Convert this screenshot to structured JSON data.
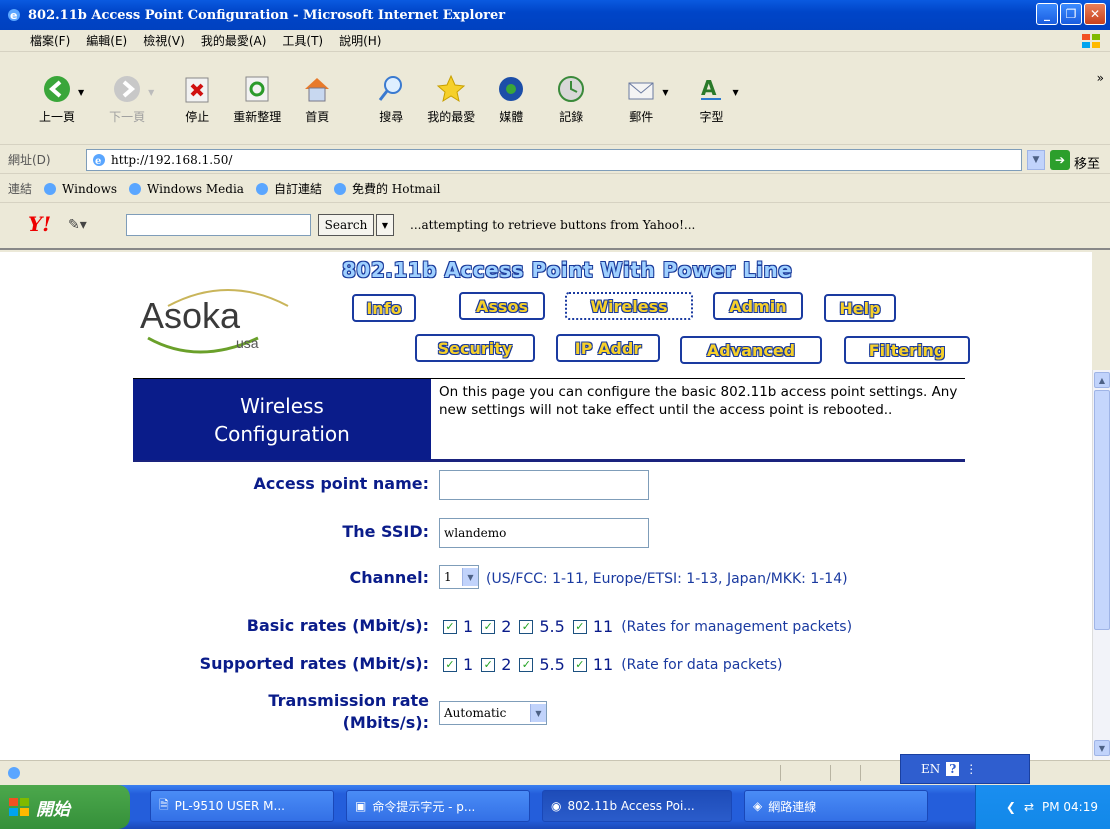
{
  "window": {
    "title": "802.11b Access Point Configuration - Microsoft Internet Explorer"
  },
  "menu": [
    "檔案(F)",
    "編輯(E)",
    "檢視(V)",
    "我的最愛(A)",
    "工具(T)",
    "說明(H)"
  ],
  "toolbar": {
    "back": "上一頁",
    "forward": "下一頁",
    "stop": "停止",
    "refresh": "重新整理",
    "home": "首頁",
    "search": "搜尋",
    "favorites": "我的最愛",
    "media": "媒體",
    "history": "記錄",
    "mail": "郵件",
    "font": "字型",
    "more": "»"
  },
  "address": {
    "label": "網址(D)",
    "url": "http://192.168.1.50/",
    "go": "移至"
  },
  "links": {
    "label": "連結",
    "items": [
      "Windows",
      "Windows Media",
      "自訂連結",
      "免費的 Hotmail"
    ]
  },
  "yahoo": {
    "logo": "Y!",
    "search_button": "Search",
    "message": "...attempting to retrieve buttons from Yahoo!..."
  },
  "page": {
    "heading": "802.11b Access Point With Power Line",
    "logo_text": "Asoka",
    "logo_sub": "usa",
    "nav_row1": [
      "Info",
      "Assos",
      "Wireless",
      "Admin",
      "Help"
    ],
    "nav_row2": [
      "Security",
      "IP Addr",
      "Advanced",
      "Filtering"
    ],
    "section_title_1": "Wireless",
    "section_title_2": "Configuration",
    "section_desc": "On this page you can configure the basic 802.11b access point settings. Any new settings will not take effect until the access point is rebooted..",
    "ap_name_label": "Access point name:",
    "ap_name_value": "",
    "ssid_label": "The SSID:",
    "ssid_value": "wlandemo",
    "channel_label": "Channel:",
    "channel_value": "1",
    "channel_hint": "(US/FCC: 1-11, Europe/ETSI: 1-13, Japan/MKK: 1-14)",
    "basic_rates_label": "Basic rates (Mbit/s):",
    "basic_rates_note": "(Rates for management packets)",
    "supported_rates_label": "Supported rates (Mbit/s):",
    "supported_rates_note": "(Rate for data packets)",
    "rates": [
      "1",
      "2",
      "5.5",
      "11"
    ],
    "tx_rate_label_1": "Transmission rate",
    "tx_rate_label_2": "(Mbits/s):",
    "tx_rate_value": "Automatic"
  },
  "langbar": {
    "lang": "EN",
    "help": "?"
  },
  "taskbar": {
    "start": "開始",
    "tasks": [
      "PL-9510 USER M...",
      "命令提示字元 - p...",
      "802.11b Access Poi...",
      "網路連線"
    ],
    "clock": "PM 04:19"
  }
}
